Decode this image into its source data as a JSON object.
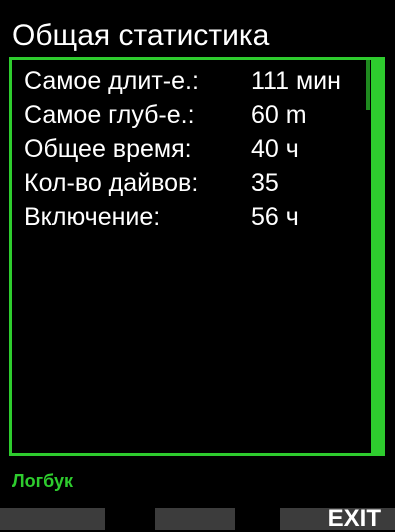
{
  "header": {
    "title": "Общая статистика"
  },
  "stats": [
    {
      "label": "Самое длит-е.:",
      "value": "111  мин"
    },
    {
      "label": "Самое глуб-е.:",
      "value": "60 m"
    },
    {
      "label": "Общее время:",
      "value": "40 ч"
    },
    {
      "label": "Кол-во дайвов:",
      "value": "35"
    },
    {
      "label": "Включение:",
      "value": "56 ч"
    }
  ],
  "footer": {
    "context_label": "Логбук"
  },
  "softkeys": {
    "left_label": "",
    "middle_label": "",
    "right_label": "EXIT"
  },
  "colors": {
    "accent": "#2ecc2e",
    "background": "#000000",
    "text": "#ffffff",
    "softkey": "#3c3c3c"
  }
}
